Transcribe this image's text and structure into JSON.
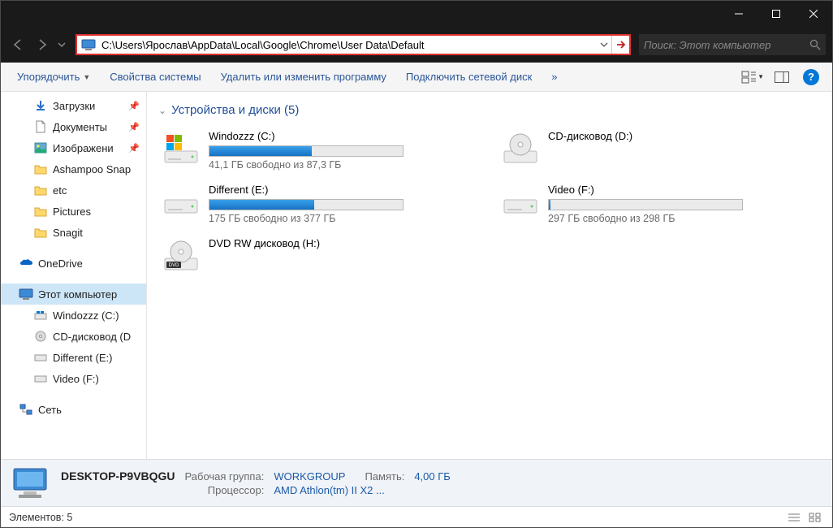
{
  "address_path": "C:\\Users\\Ярослав\\AppData\\Local\\Google\\Chrome\\User Data\\Default",
  "search_placeholder": "Поиск: Этот компьютер",
  "toolbar": {
    "organize": "Упорядочить",
    "properties": "Свойства системы",
    "uninstall": "Удалить или изменить программу",
    "map_drive": "Подключить сетевой диск",
    "more": "»"
  },
  "sidebar": {
    "downloads": "Загрузки",
    "documents": "Документы",
    "images": "Изображени",
    "ashampoo": "Ashampoo Snap",
    "etc": "etc",
    "pictures": "Pictures",
    "snagit": "Snagit",
    "onedrive": "OneDrive",
    "this_pc": "Этот компьютер",
    "drive_c": "Windozzz (C:)",
    "drive_d": "CD-дисковод (D",
    "drive_e": "Different (E:)",
    "drive_f": "Video (F:)",
    "network": "Сеть"
  },
  "group_header": "Устройства и диски (5)",
  "drives": {
    "c": {
      "name": "Windozzz (C:)",
      "free": "41,1 ГБ свободно из 87,3 ГБ",
      "fill_pct": 53
    },
    "d": {
      "name": "CD-дисковод (D:)"
    },
    "e": {
      "name": "Different (E:)",
      "free": "175 ГБ свободно из 377 ГБ",
      "fill_pct": 54
    },
    "f": {
      "name": "Video (F:)",
      "free": "297 ГБ свободно из 298 ГБ",
      "fill_pct": 1
    },
    "h": {
      "name": "DVD RW дисковод (H:)"
    }
  },
  "details": {
    "name": "DESKTOP-P9VBQGU",
    "workgroup_lbl": "Рабочая группа:",
    "workgroup_val": "WORKGROUP",
    "memory_lbl": "Память:",
    "memory_val": "4,00 ГБ",
    "cpu_lbl": "Процессор:",
    "cpu_val": "AMD Athlon(tm) II X2 ..."
  },
  "status_text": "Элементов: 5"
}
